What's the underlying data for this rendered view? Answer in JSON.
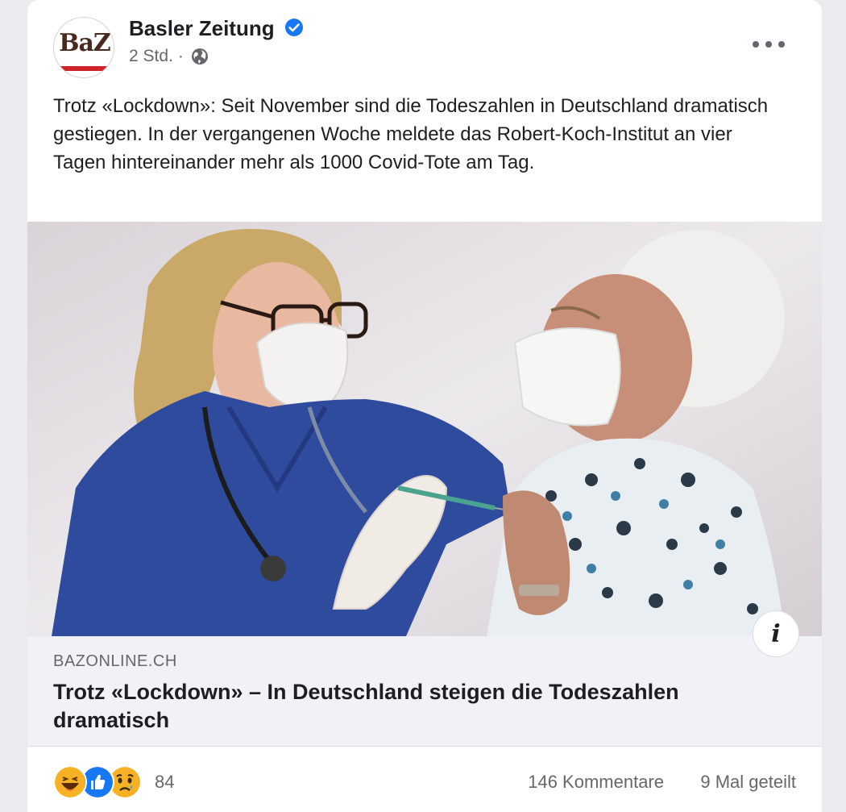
{
  "post": {
    "page_name": "Basler Zeitung",
    "logo_text": "BaZ",
    "time": "2 Std.",
    "separator": "·",
    "text": "Trotz «Lockdown»: Seit November sind die Todeszahlen in Deutschland dramatisch gestiegen. In der vergangenen Woche meldete das Robert-Koch-Institut an vier Tagen hintereinander mehr als 1000 Covid-Tote am Tag."
  },
  "link": {
    "domain": "BAZONLINE.CH",
    "title": "Trotz «Lockdown» – In Deutschland steigen die Todeszahlen dramatisch",
    "info_label": "i"
  },
  "footer": {
    "reaction_count": "84",
    "comments": "146 Kommentare",
    "shares": "9 Mal geteilt",
    "reactions": [
      "haha-icon",
      "like-icon",
      "sad-icon"
    ]
  },
  "colors": {
    "verified": "#1877f2",
    "like": "#1877f2",
    "emoji": "#f7b125",
    "text": "#1c1e21",
    "muted": "#65676b",
    "link_bg": "#f0f2f5"
  }
}
